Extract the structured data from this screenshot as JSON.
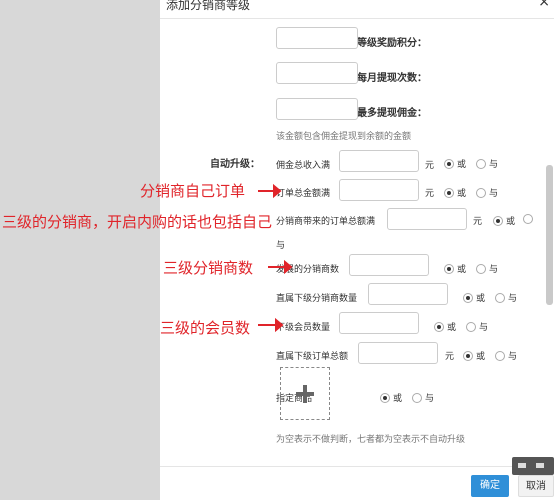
{
  "dialog": {
    "title": "添加分销商等级",
    "close_icon": "close-icon"
  },
  "fields": {
    "reward_points_label": "升到此等级奖励积分：",
    "monthly_withdraw_times_label": "每月提现次数：",
    "monthly_max_withdraw_label": "每月最多提现佣金：",
    "withdraw_hint": "该金额包含佣金提现到余额的金额",
    "auto_upgrade_label": "自动升级：",
    "commission_total_label": "佣金总收入满",
    "order_total_label": "订单总金额满",
    "brought_orders_label": "分销商带来的订单总额满",
    "developed_count_label": "发展的分销商数",
    "direct_sub_distributors_label": "直属下级分销商数量",
    "sub_members_label": "下级会员数量",
    "direct_sub_order_total_label": "直属下级订单总额",
    "designated_product_label": "指定商品",
    "bottom_hint": "为空表示不做判断，七者都为空表示不自动升级",
    "unit_yuan": "元",
    "or_label": "或",
    "and_label": "与"
  },
  "buttons": {
    "confirm": "确定",
    "cancel": "取消"
  },
  "annotations": {
    "own_orders": "分销商自己订单",
    "three_level_note": "三级的分销商，开启内购的话也包括自己",
    "three_level_distributors": "三级分销商数",
    "three_level_members": "三级的会员数"
  },
  "colors": {
    "annotation": "#e0242a",
    "primary_button": "#2f8fd8"
  },
  "icons": {
    "upload": "plus-icon"
  }
}
